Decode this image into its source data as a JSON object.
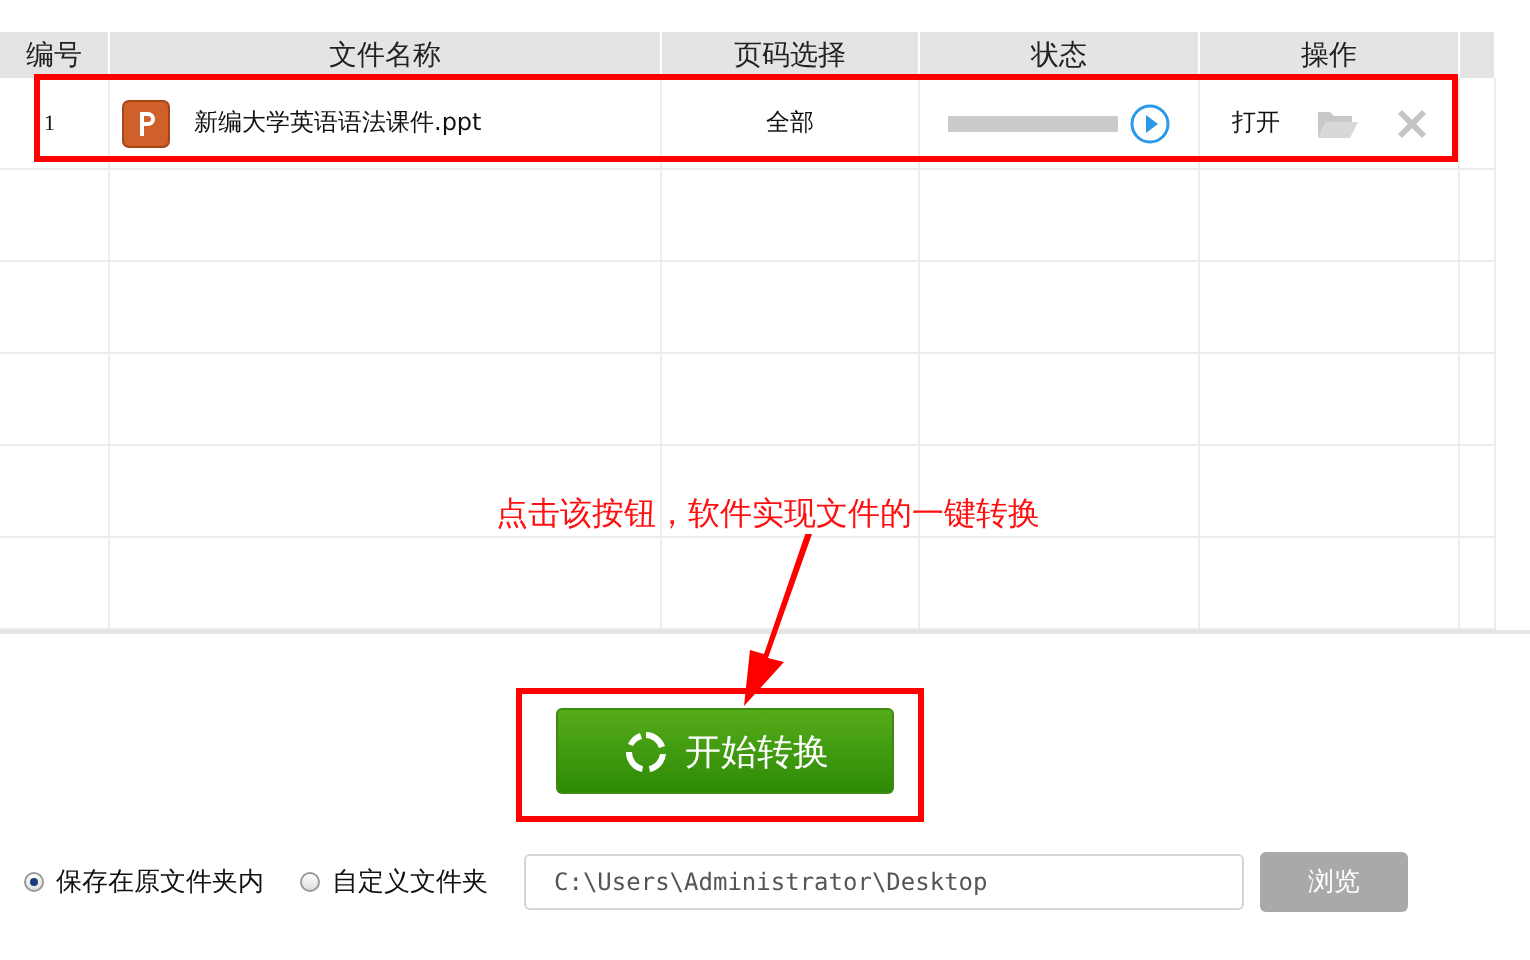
{
  "table": {
    "columns": [
      "编号",
      "文件名称",
      "页码选择",
      "状态",
      "操作"
    ],
    "rows": [
      {
        "number": "1",
        "file_name": "新编大学英语语法课件.ppt",
        "pages": "全部",
        "progress": {
          "level": 0
        },
        "open_label": "打开",
        "selected": true
      }
    ]
  },
  "annotation": {
    "text": "点击该按钮，软件实现文件的一键转换"
  },
  "start_button": {
    "label": "开始转换"
  },
  "save_options": [
    {
      "label": "保存在原文件夹内",
      "selected": true
    },
    {
      "label": "自定义文件夹",
      "selected": false
    }
  ],
  "path_field": {
    "value": "C:\\Users\\Administrator\\Desktop"
  },
  "browse_button": {
    "label": "浏览",
    "disabled": true
  }
}
